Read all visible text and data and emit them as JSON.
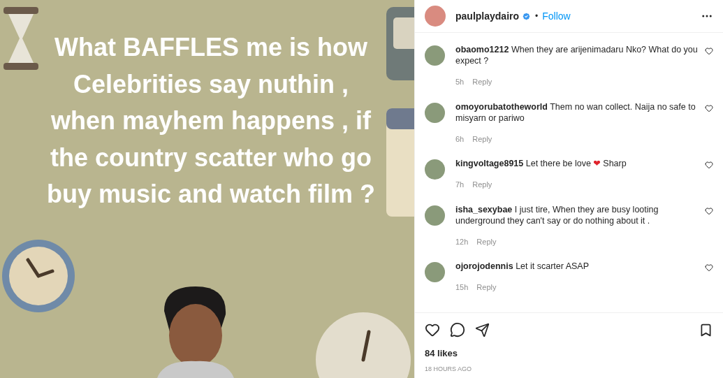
{
  "post_image": {
    "caption": "What BAFFLES me is how Celebrities say nuthin , when mayhem happens , if the country scatter who go buy music and watch film ?"
  },
  "header": {
    "username": "paulplaydairo",
    "verified": true,
    "separator": "•",
    "follow": "Follow"
  },
  "comments": [
    {
      "username": "obaomo1212",
      "text": "When they are arijenimadaru Nko? What do you expect ?",
      "time": "5h",
      "reply": "Reply"
    },
    {
      "username": "omoyorubatotheworld",
      "text": "Them no wan collect. Naija no safe to misyarn or pariwo",
      "time": "6h",
      "reply": "Reply"
    },
    {
      "username": "kingvoltage8915",
      "text": "Let there be love",
      "emoji": "❤",
      "text_after": "Sharp",
      "time": "7h",
      "reply": "Reply"
    },
    {
      "username": "isha_sexybae",
      "text": "I just tire, When they are busy looting underground they can't say or do nothing about it .",
      "time": "12h",
      "reply": "Reply"
    },
    {
      "username": "ojorojodennis",
      "text": "Let it scarter ASAP",
      "time": "15h",
      "reply": "Reply"
    }
  ],
  "likes": "84 likes",
  "posted": "18 HOURS AGO"
}
